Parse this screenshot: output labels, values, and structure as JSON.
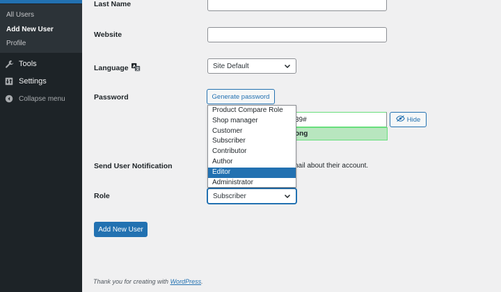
{
  "sidebar": {
    "submenu": [
      "All Users",
      "Add New User",
      "Profile"
    ],
    "items": [
      {
        "label": "Tools",
        "icon": "wrench-icon"
      },
      {
        "label": "Settings",
        "icon": "settings-icon"
      },
      {
        "label": "Collapse menu",
        "icon": "collapse-icon"
      }
    ]
  },
  "form": {
    "last_name_label": "Last Name",
    "website_label": "Website",
    "language_label": "Language",
    "language_value": "Site Default",
    "password_label": "Password",
    "generate_password_label": "Generate password",
    "password_value_partial": "39#",
    "strength_partial": "ong",
    "hide_label": "Hide",
    "send_notification_label": "Send User Notification",
    "notification_text_partial": "nail about their account.",
    "role_label": "Role",
    "role_value": "Subscriber",
    "role_options": [
      "Product Compare Role",
      "Shop manager",
      "Customer",
      "Subscriber",
      "Contributor",
      "Author",
      "Editor",
      "Administrator"
    ],
    "role_highlighted": "Editor",
    "submit_label": "Add New User"
  },
  "footer": {
    "prefix": "Thank you for creating with ",
    "link": "WordPress",
    "suffix": "."
  },
  "colors": {
    "accent": "#2271b1",
    "sidebar_bg": "#1d2327",
    "strength_good_bg": "#b8e6bf"
  }
}
